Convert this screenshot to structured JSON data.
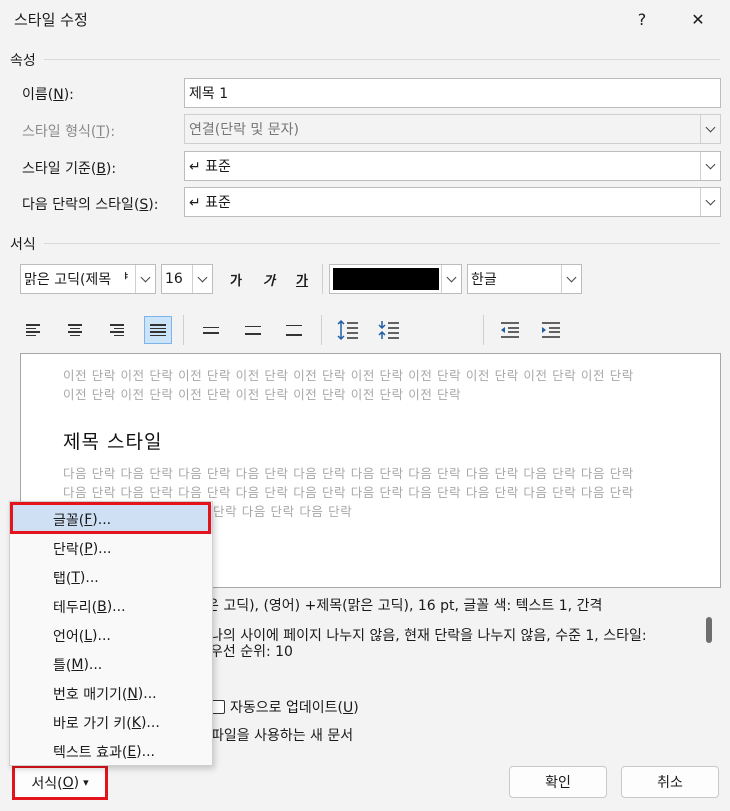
{
  "window": {
    "title": "스타일 수정",
    "help_label": "?",
    "close_label": "✕"
  },
  "properties": {
    "section_label": "속성",
    "name": {
      "label": "이름(",
      "key": "N",
      "suffix": "):",
      "value": "제목 1"
    },
    "style_type": {
      "label": "스타일 형식(",
      "key": "T",
      "suffix": "):",
      "value": "연결(단락 및 문자)"
    },
    "based_on": {
      "label": "스타일 기준(",
      "key": "B",
      "suffix": "):",
      "value": "↵ 표준"
    },
    "next_style": {
      "label": "다음 단락의 스타일(",
      "key": "S",
      "suffix": "):",
      "value": "↵ 표준"
    }
  },
  "formatting": {
    "section_label": "서식",
    "font": "맑은 고딕(제목 ᅣ",
    "size": "16",
    "bold_label": "가",
    "italic_label": "가",
    "underline_label": "가",
    "font_color": "#000000",
    "script": "한글"
  },
  "alignment_icons": [
    "align-left-icon",
    "align-center-icon",
    "align-right-icon",
    "align-justify-icon",
    "line-spacing-single-icon",
    "line-spacing-onehalf-icon",
    "line-spacing-double-icon",
    "space-before-icon",
    "space-after-icon",
    "decrease-indent-icon",
    "increase-indent-icon"
  ],
  "preview": {
    "prev_line1": "이전 단락 이전 단락 이전 단락 이전 단락 이전 단락 이전 단락 이전 단락 이전 단락 이전 단락 이전 단락",
    "prev_line2": "이전 단락 이전 단락 이전 단락 이전 단락 이전 단락 이전 단락 이전 단락",
    "heading": "제목 스타일",
    "next_line1": "다음 단락 다음 단락 다음 단락 다음 단락 다음 단락 다음 단락 다음 단락 다음 단락 다음 단락 다음 단락",
    "next_line2": "다음 단락 다음 단락 다음 단락 다음 단락 다음 단락 다음 단락 다음 단락 다음 단락 다음 단락 다음 단락",
    "next_line3": "단락 다음 단락 다음 단락"
  },
  "description": {
    "line1": "은 고딕), (영어) +제목(맑은 고딕), 16 pt, 글꼴 색: 텍스트 1, 간격",
    "line2": "나의 사이에 페이지 나누지 않음, 현재 단락을 나누지 않음, 수준 1, 스타일:",
    "line3": "우선 순위: 10"
  },
  "options": {
    "auto_update": {
      "label": "자동으로 업데이트(",
      "key": "U",
      "suffix": ")"
    },
    "new_documents": "파일을 사용하는 새 문서"
  },
  "format_menu": {
    "items": [
      {
        "label": "글꼴(",
        "key": "F",
        "suffix": ")..."
      },
      {
        "label": "단락(",
        "key": "P",
        "suffix": ")..."
      },
      {
        "label": "탭(",
        "key": "T",
        "suffix": ")..."
      },
      {
        "label": "테두리(",
        "key": "B",
        "suffix": ")..."
      },
      {
        "label": "언어(",
        "key": "L",
        "suffix": ")..."
      },
      {
        "label": "틀(",
        "key": "M",
        "suffix": ")..."
      },
      {
        "label": "번호 매기기(",
        "key": "N",
        "suffix": ")..."
      },
      {
        "label": "바로 가기 키(",
        "key": "K",
        "suffix": ")..."
      },
      {
        "label": "텍스트 효과(",
        "key": "E",
        "suffix": ")..."
      }
    ]
  },
  "buttons": {
    "format": {
      "label": "서식(",
      "key": "O",
      "suffix": ")",
      "arrow": "▾"
    },
    "ok": "확인",
    "cancel": "취소"
  },
  "colors": {
    "highlight_outline": "#e3141c",
    "menu_highlight": "#cfe0f5",
    "active_button": "#cce4f7"
  }
}
